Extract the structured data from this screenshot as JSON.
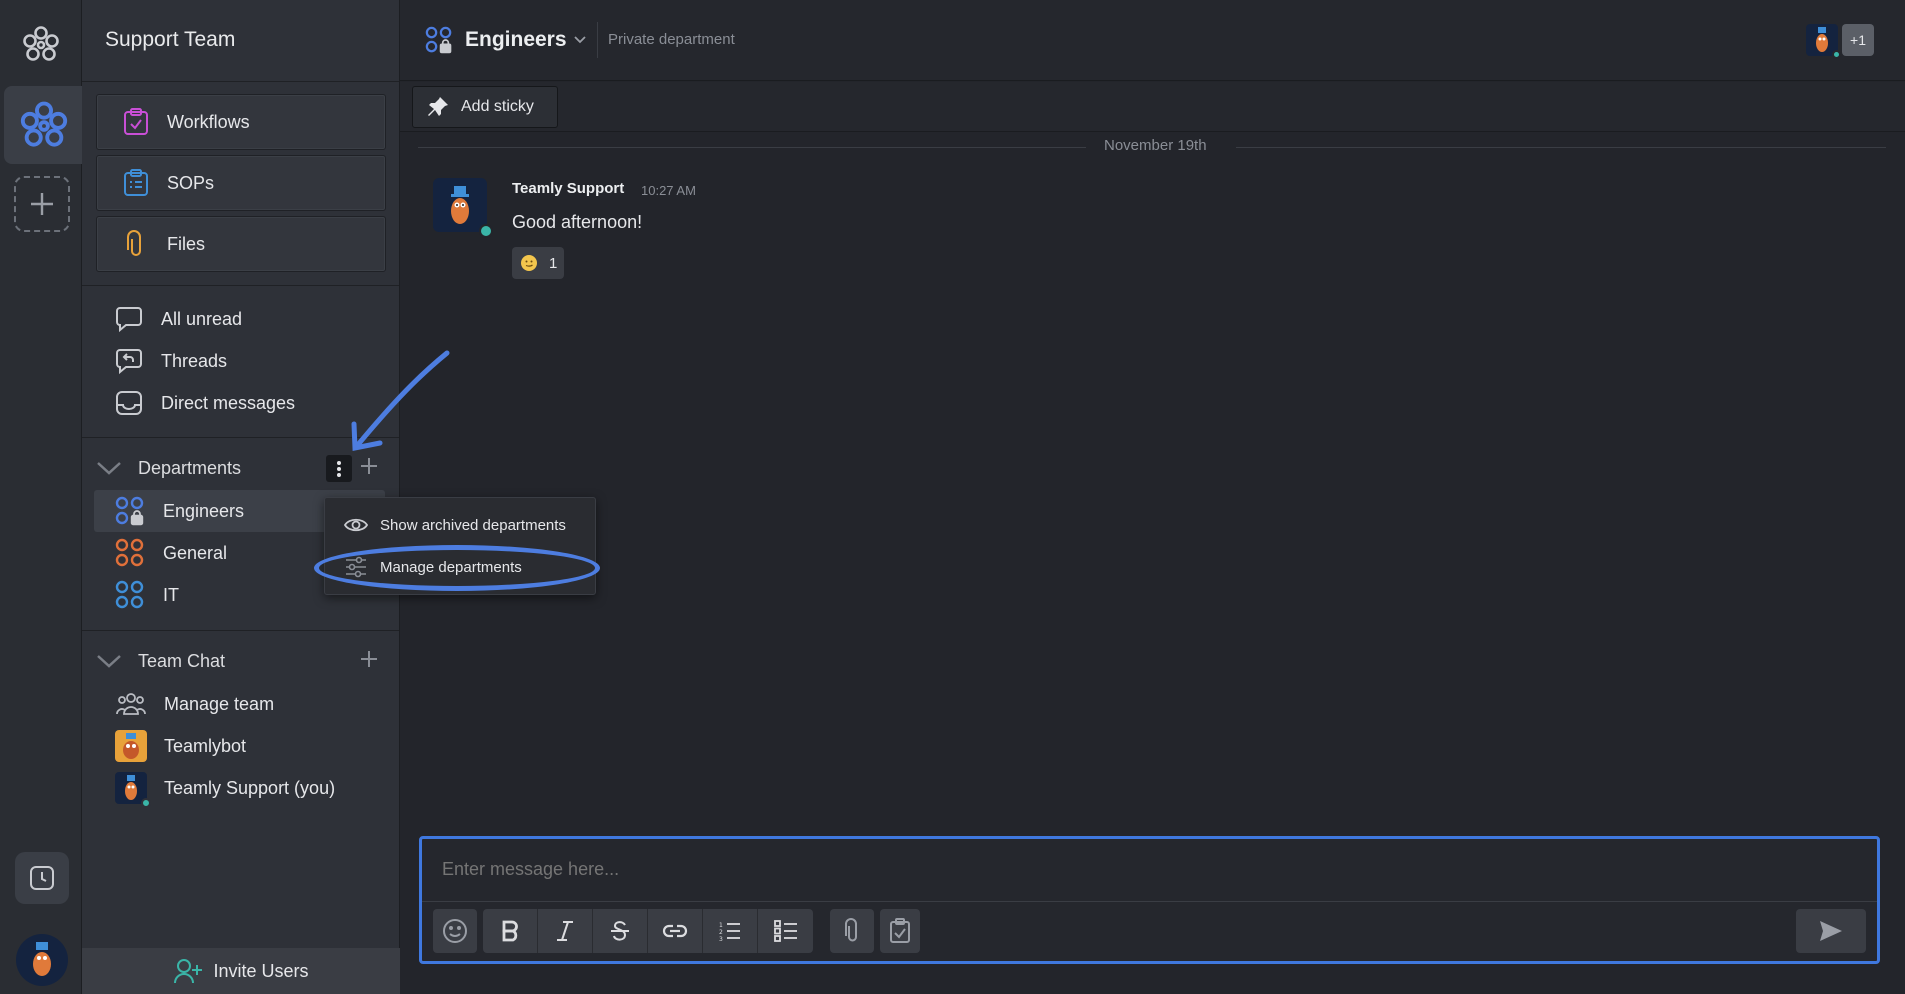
{
  "sidebar": {
    "team_name": "Support Team",
    "tools": [
      {
        "label": "Workflows",
        "icon": "workflows-icon"
      },
      {
        "label": "SOPs",
        "icon": "sops-icon"
      },
      {
        "label": "Files",
        "icon": "paperclip-icon"
      }
    ],
    "nav": [
      {
        "label": "All unread",
        "icon": "chat-bubble-icon"
      },
      {
        "label": "Threads",
        "icon": "threads-icon"
      },
      {
        "label": "Direct messages",
        "icon": "inbox-icon"
      }
    ],
    "departments_label": "Departments",
    "departments": [
      {
        "label": "Engineers",
        "color": "#4d7de0",
        "private": true
      },
      {
        "label": "General",
        "color": "#e0703a",
        "private": false
      },
      {
        "label": "IT",
        "color": "#3f8fd8",
        "private": false
      }
    ],
    "team_chat_label": "Team Chat",
    "members": [
      {
        "label": "Manage team",
        "icon": "people-icon"
      },
      {
        "label": "Teamlybot",
        "icon": "teamlybot-avatar"
      },
      {
        "label": "Teamly Support (you)",
        "icon": "teamly-support-avatar"
      }
    ],
    "invite_label": "Invite Users"
  },
  "header": {
    "title": "Engineers",
    "subtitle": "Private department",
    "extra_members": "+1"
  },
  "stickybar": {
    "add_sticky_label": "Add sticky"
  },
  "conversation": {
    "date_label": "November 19th",
    "messages": [
      {
        "author": "Teamly Support",
        "time": "10:27 AM",
        "text": "Good afternoon!",
        "reaction_count": "1"
      }
    ]
  },
  "menu": {
    "items": [
      {
        "label": "Show archived departments",
        "icon": "eye-icon"
      },
      {
        "label": "Manage departments",
        "icon": "sliders-icon"
      }
    ]
  },
  "composer": {
    "placeholder": "Enter message here..."
  },
  "colors": {
    "accent": "#4d7de0",
    "online": "#3ab5a8",
    "annotation": "#4d7de0"
  }
}
